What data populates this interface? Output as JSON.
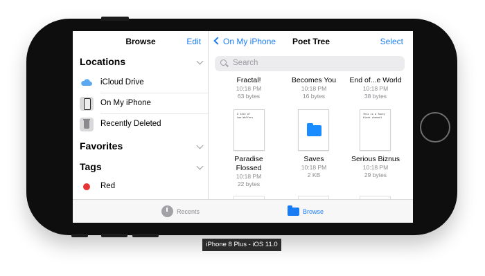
{
  "caption": "iPhone 8 Plus - iOS 11.0",
  "sidebar": {
    "title": "Browse",
    "edit": "Edit",
    "locations_header": "Locations",
    "locations": [
      {
        "label": "iCloud Drive",
        "icon": "cloud-icon"
      },
      {
        "label": "On My iPhone",
        "icon": "phone-icon"
      },
      {
        "label": "Recently Deleted",
        "icon": "trash-icon"
      }
    ],
    "favorites_header": "Favorites",
    "tags_header": "Tags",
    "tags": [
      {
        "label": "Red",
        "color": "#e53535"
      }
    ]
  },
  "main": {
    "back_label": "On My iPhone",
    "title": "Poet Tree",
    "select": "Select",
    "search_placeholder": "Search",
    "top_row": [
      {
        "name": "Fractal!",
        "time": "10:18 PM",
        "size": "63 bytes"
      },
      {
        "name": "Becomes You",
        "time": "10:18 PM",
        "size": "16 bytes"
      },
      {
        "name": "End of...e World",
        "time": "10:18 PM",
        "size": "38 bytes"
      }
    ],
    "second_row": [
      {
        "name_line1": "Paradise",
        "name_line2": "Flossed",
        "time": "10:18 PM",
        "size": "22 bytes",
        "snippet": "A tale of\ntwo Wolfers"
      },
      {
        "name_line1": "Saves",
        "name_line2": "",
        "time": "10:18 PM",
        "size": "2 KB",
        "snippet": ""
      },
      {
        "name_line1": "Serious Biznus",
        "name_line2": "",
        "time": "10:18 PM",
        "size": "29 bytes",
        "snippet": "This is a funny\nblack channel"
      }
    ]
  },
  "tabbar": {
    "recents": "Recents",
    "browse": "Browse",
    "accent": "#1a7cf5"
  }
}
